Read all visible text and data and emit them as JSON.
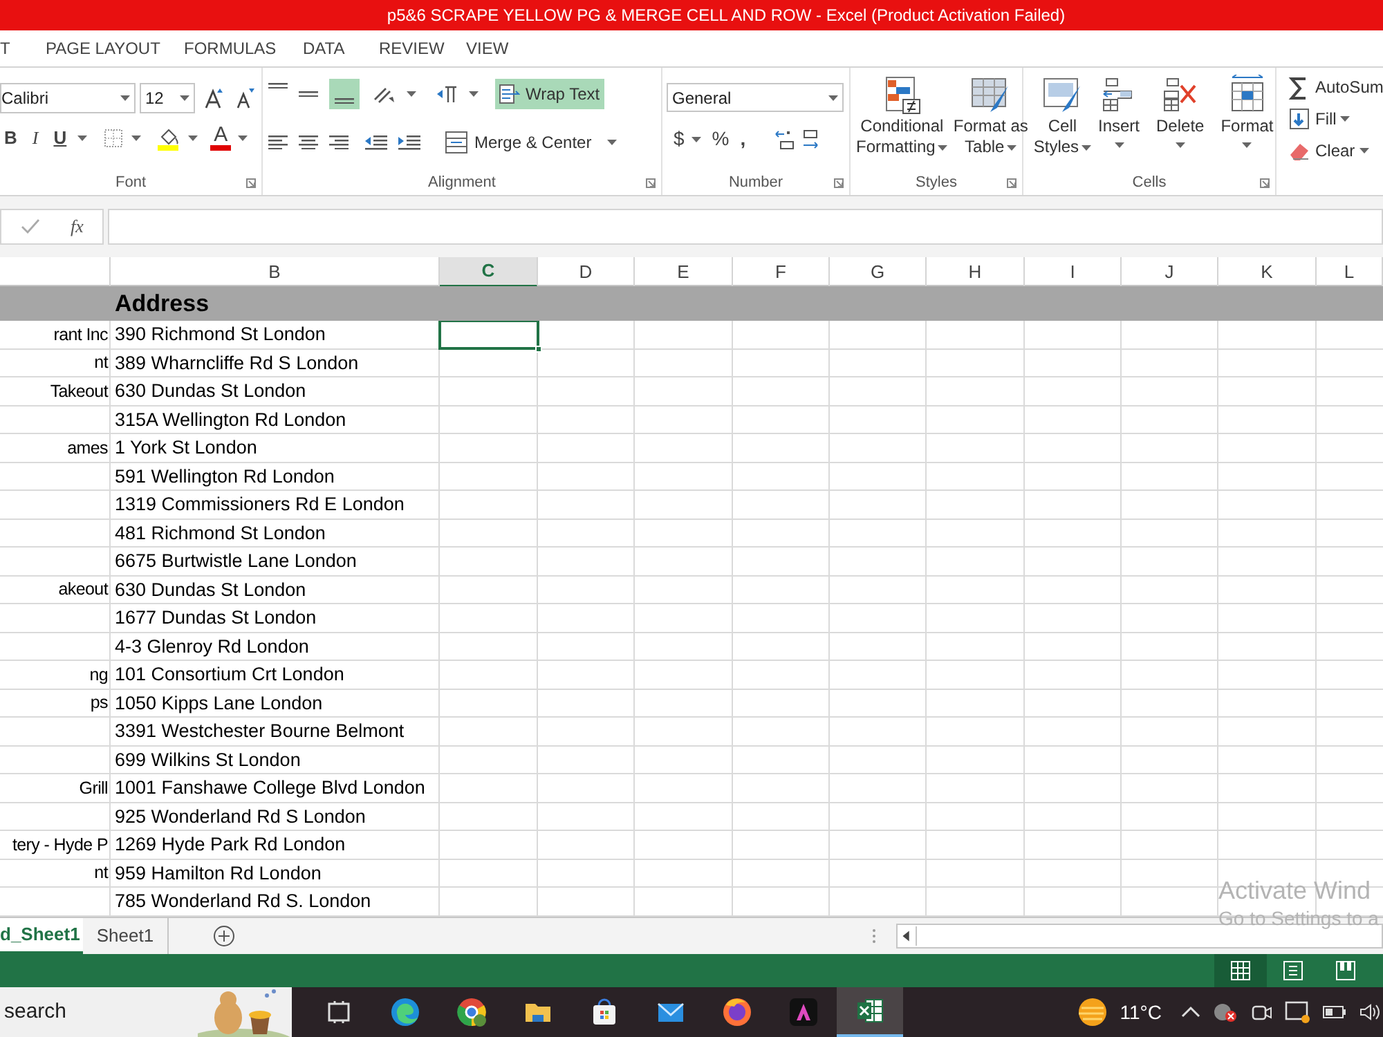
{
  "window": {
    "title": "p5&6 SCRAPE YELLOW PG & MERGE CELL AND ROW -  Excel (Product Activation Failed)"
  },
  "menu_tabs": [
    {
      "label": "T",
      "selected": false
    },
    {
      "label": "PAGE LAYOUT",
      "selected": false
    },
    {
      "label": "FORMULAS",
      "selected": false
    },
    {
      "label": "DATA",
      "selected": false
    },
    {
      "label": "REVIEW",
      "selected": false
    },
    {
      "label": "VIEW",
      "selected": false
    }
  ],
  "ribbon": {
    "font": {
      "name": "Calibri",
      "size": "12",
      "bold": "B",
      "italic": "I",
      "underline": "U",
      "font_color": "A",
      "group_label": "Font"
    },
    "alignment": {
      "bottom_align_on": true,
      "wrap_text": {
        "label": "Wrap Text",
        "on": true
      },
      "merge": "Merge & Center",
      "group_label": "Alignment"
    },
    "number": {
      "format": "General",
      "currency": "$",
      "percent": "%",
      "comma": ",",
      "group_label": "Number"
    },
    "styles": {
      "buttons": [
        {
          "kind": "conditional",
          "lines": [
            "Conditional",
            "Formatting"
          ]
        },
        {
          "kind": "table",
          "lines": [
            "Format as",
            "Table"
          ]
        },
        {
          "kind": "cellstyles",
          "lines": [
            "Cell",
            "Styles"
          ]
        }
      ],
      "group_label": "Styles"
    },
    "cells": {
      "buttons": [
        {
          "kind": "insert",
          "label": "Insert"
        },
        {
          "kind": "delete",
          "label": "Delete"
        },
        {
          "kind": "format",
          "label": "Format"
        }
      ],
      "group_label": "Cells"
    },
    "editing": {
      "buttons": [
        {
          "kind": "autosum",
          "label": "AutoSum"
        },
        {
          "kind": "fill",
          "label": "Fill"
        },
        {
          "kind": "clear",
          "label": "Clear"
        }
      ]
    }
  },
  "formula_bar": {
    "fx": "fx"
  },
  "columns": [
    {
      "label": "B",
      "selected": false
    },
    {
      "label": "C",
      "selected": true
    },
    {
      "label": "D",
      "selected": false
    },
    {
      "label": "E",
      "selected": false
    },
    {
      "label": "F",
      "selected": false
    },
    {
      "label": "G",
      "selected": false
    },
    {
      "label": "H",
      "selected": false
    },
    {
      "label": "I",
      "selected": false
    },
    {
      "label": "J",
      "selected": false
    },
    {
      "label": "K",
      "selected": false
    },
    {
      "label": "L",
      "selected": false
    }
  ],
  "header_row": {
    "b": "Address"
  },
  "rows": [
    {
      "a": "rant Inc",
      "b": "390 Richmond St London",
      "selected": true
    },
    {
      "a": "nt",
      "b": "389 Wharncliffe Rd S London",
      "selected": false
    },
    {
      "a": "Takeout",
      "b": "630 Dundas St London",
      "selected": false
    },
    {
      "b": "315A Wellington Rd London",
      "selected": false
    },
    {
      "a": "ames",
      "b": "1 York St London",
      "selected": false
    },
    {
      "b": "591 Wellington Rd London",
      "selected": false
    },
    {
      "b": "1319 Commissioners Rd E London",
      "selected": false
    },
    {
      "b": "481 Richmond St London",
      "selected": false
    },
    {
      "b": "6675 Burtwistle Lane London",
      "selected": false
    },
    {
      "a": "akeout",
      "b": "630 Dundas St London",
      "selected": false
    },
    {
      "b": "1677 Dundas St London",
      "selected": false
    },
    {
      "b": "4-3 Glenroy Rd London",
      "selected": false
    },
    {
      "a": "ng",
      "b": "101 Consortium Crt London",
      "selected": false
    },
    {
      "a": "ps",
      "b": "1050 Kipps Lane London",
      "selected": false
    },
    {
      "b": "3391 Westchester Bourne Belmont",
      "selected": false
    },
    {
      "b": "699 Wilkins St London",
      "selected": false
    },
    {
      "a": "Grill",
      "b": "1001 Fanshawe College Blvd London",
      "selected": false
    },
    {
      "b": "925 Wonderland Rd S London",
      "selected": false
    },
    {
      "a": "tery - Hyde P",
      "b": "1269 Hyde Park Rd London",
      "selected": false
    },
    {
      "a": "nt",
      "b": "959 Hamilton Rd London",
      "selected": false
    },
    {
      "b": "785 Wonderland Rd S. London",
      "selected": false
    }
  ],
  "sheet_tabs": [
    {
      "label": "d_Sheet1",
      "selected": true
    },
    {
      "label": "Sheet1",
      "selected": false
    }
  ],
  "status_bar": {
    "views": [
      {
        "kind": "normal",
        "selected": true
      },
      {
        "kind": "layout",
        "selected": false
      },
      {
        "kind": "pagebreak",
        "selected": false
      }
    ]
  },
  "activation_notice": [
    "Activate Wind",
    "Go to Settings to a"
  ],
  "taskbar": {
    "search": "search",
    "apps": [
      {
        "kind": "taskview",
        "selected": false
      },
      {
        "kind": "edge",
        "selected": false
      },
      {
        "kind": "chrome",
        "selected": false
      },
      {
        "kind": "folder",
        "selected": false
      },
      {
        "kind": "store",
        "selected": false
      },
      {
        "kind": "mail",
        "selected": false
      },
      {
        "kind": "firefox",
        "selected": false
      },
      {
        "kind": "adobe",
        "selected": false
      },
      {
        "kind": "excel",
        "selected": true
      }
    ],
    "temperature": "11°C"
  }
}
